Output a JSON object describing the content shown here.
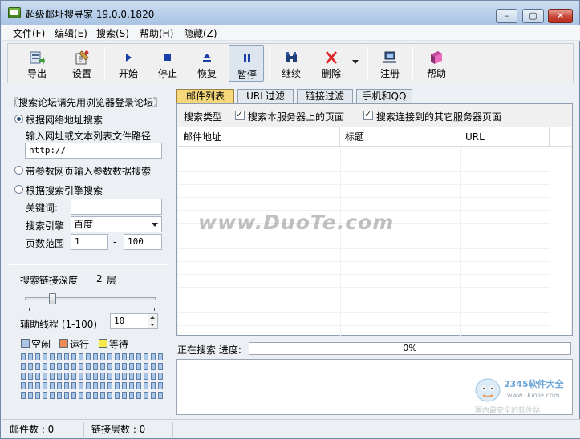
{
  "window": {
    "title": "超级邮址搜寻家 19.0.0.1820",
    "min": "–",
    "max": "▢",
    "close": "✕"
  },
  "menu": [
    "文件(F)",
    "编辑(E)",
    "搜索(S)",
    "帮助(H)",
    "隐藏(Z)"
  ],
  "toolbar": {
    "export": "导出",
    "settings": "设置",
    "start": "开始",
    "stop": "停止",
    "resume": "恢复",
    "pause": "暂停",
    "continue": "继续",
    "delete": "删除",
    "register": "注册",
    "help": "帮助"
  },
  "left": {
    "heading": "〖搜索论坛请先用浏览器登录论坛〗",
    "radio_url": "根据网络地址搜索",
    "url_hint": "输入网址或文本列表文件路径",
    "url_value": "http://",
    "radio_param": "带参数网页输入参数数据搜索",
    "radio_engine": "根据搜索引擎搜索",
    "keyword_label": "关键词:",
    "keyword_value": "",
    "engine_label": "搜索引擎",
    "engine_value": "百度",
    "page_range_label": "页数范围",
    "page_from": "1",
    "page_dash": "-",
    "page_to": "100",
    "depth_label": "搜索链接深度",
    "depth_value": "2",
    "depth_unit": "层",
    "threads_label": "辅助线程 (1-100)",
    "threads_value": "10",
    "legend_idle": "空闲",
    "legend_running": "运行",
    "legend_waiting": "等待",
    "colors": {
      "idle": "#a9c6e6",
      "running": "#f08a55",
      "waiting": "#f5e84a"
    }
  },
  "tabs": [
    "邮件列表",
    "URL过滤",
    "链接过滤",
    "手机和QQ"
  ],
  "options": {
    "search_type_label": "搜索类型",
    "opt_this_server": "搜索本服务器上的页面",
    "opt_other_server": "搜索连接到的其它服务器页面"
  },
  "list": {
    "columns": [
      "邮件地址",
      "标题",
      "URL"
    ]
  },
  "status": {
    "searching": "正在搜索 进度:",
    "progress_text": "0%",
    "progress": 0
  },
  "statusbar": {
    "mail_count": "邮件数 : 0",
    "link_depth": "链接层数 : 0"
  },
  "watermark": "www.DuoTe.com",
  "corner_mark": {
    "brand": "2345软件大全",
    "site": "www.DuoTe.com",
    "note": "国内最安全的软件站"
  }
}
